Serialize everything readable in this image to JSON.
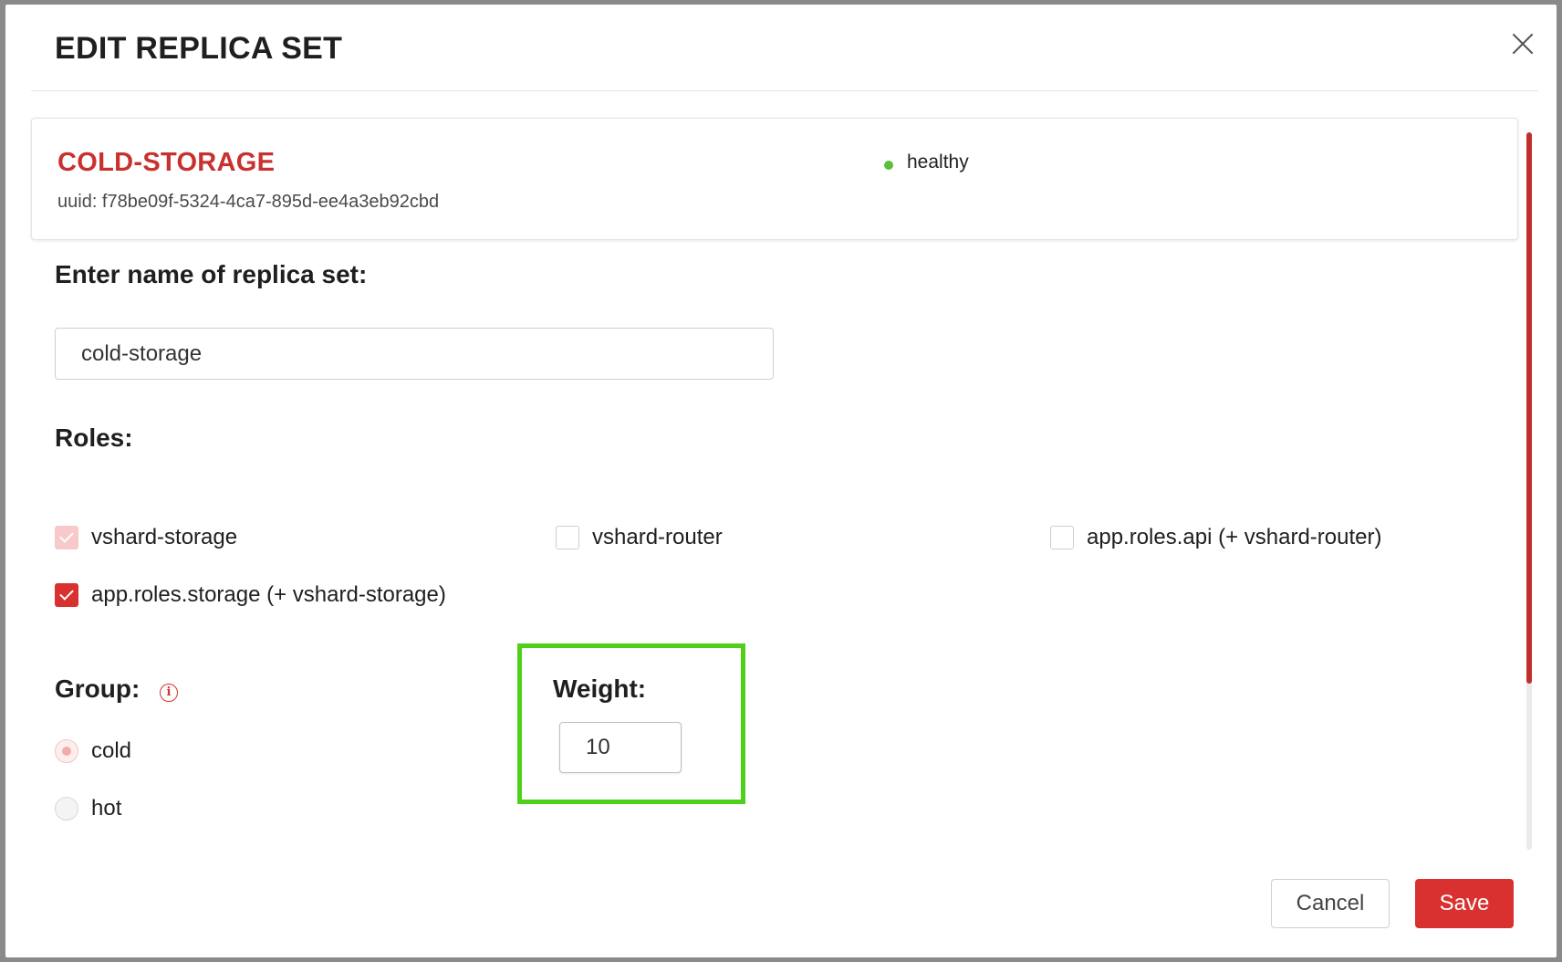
{
  "modal": {
    "title": "EDIT REPLICA SET"
  },
  "replicaset": {
    "name": "COLD-STORAGE",
    "uuid": "uuid: f78be09f-5324-4ca7-895d-ee4a3eb92cbd",
    "status": "healthy",
    "status_color": "#5bbd3a"
  },
  "name_field": {
    "label": "Enter name of replica set:",
    "value": "cold-storage"
  },
  "roles": {
    "label": "Roles:",
    "items": [
      {
        "label": "vshard-storage",
        "state": "checked-disabled"
      },
      {
        "label": "vshard-router",
        "state": "unchecked"
      },
      {
        "label": "app.roles.api (+ vshard-router)",
        "state": "unchecked"
      },
      {
        "label": "app.roles.storage (+ vshard-storage)",
        "state": "checked"
      }
    ]
  },
  "group": {
    "label": "Group:",
    "info_icon": "info-icon",
    "options": [
      {
        "label": "cold",
        "selected": true,
        "disabled": true
      },
      {
        "label": "hot",
        "selected": false,
        "disabled": true
      }
    ]
  },
  "weight": {
    "label": "Weight:",
    "value": "10",
    "highlight_color": "#4fd11c"
  },
  "footer": {
    "cancel_label": "Cancel",
    "save_label": "Save"
  },
  "colors": {
    "accent": "#d8312f",
    "accent_light": "#f7c9c9"
  }
}
